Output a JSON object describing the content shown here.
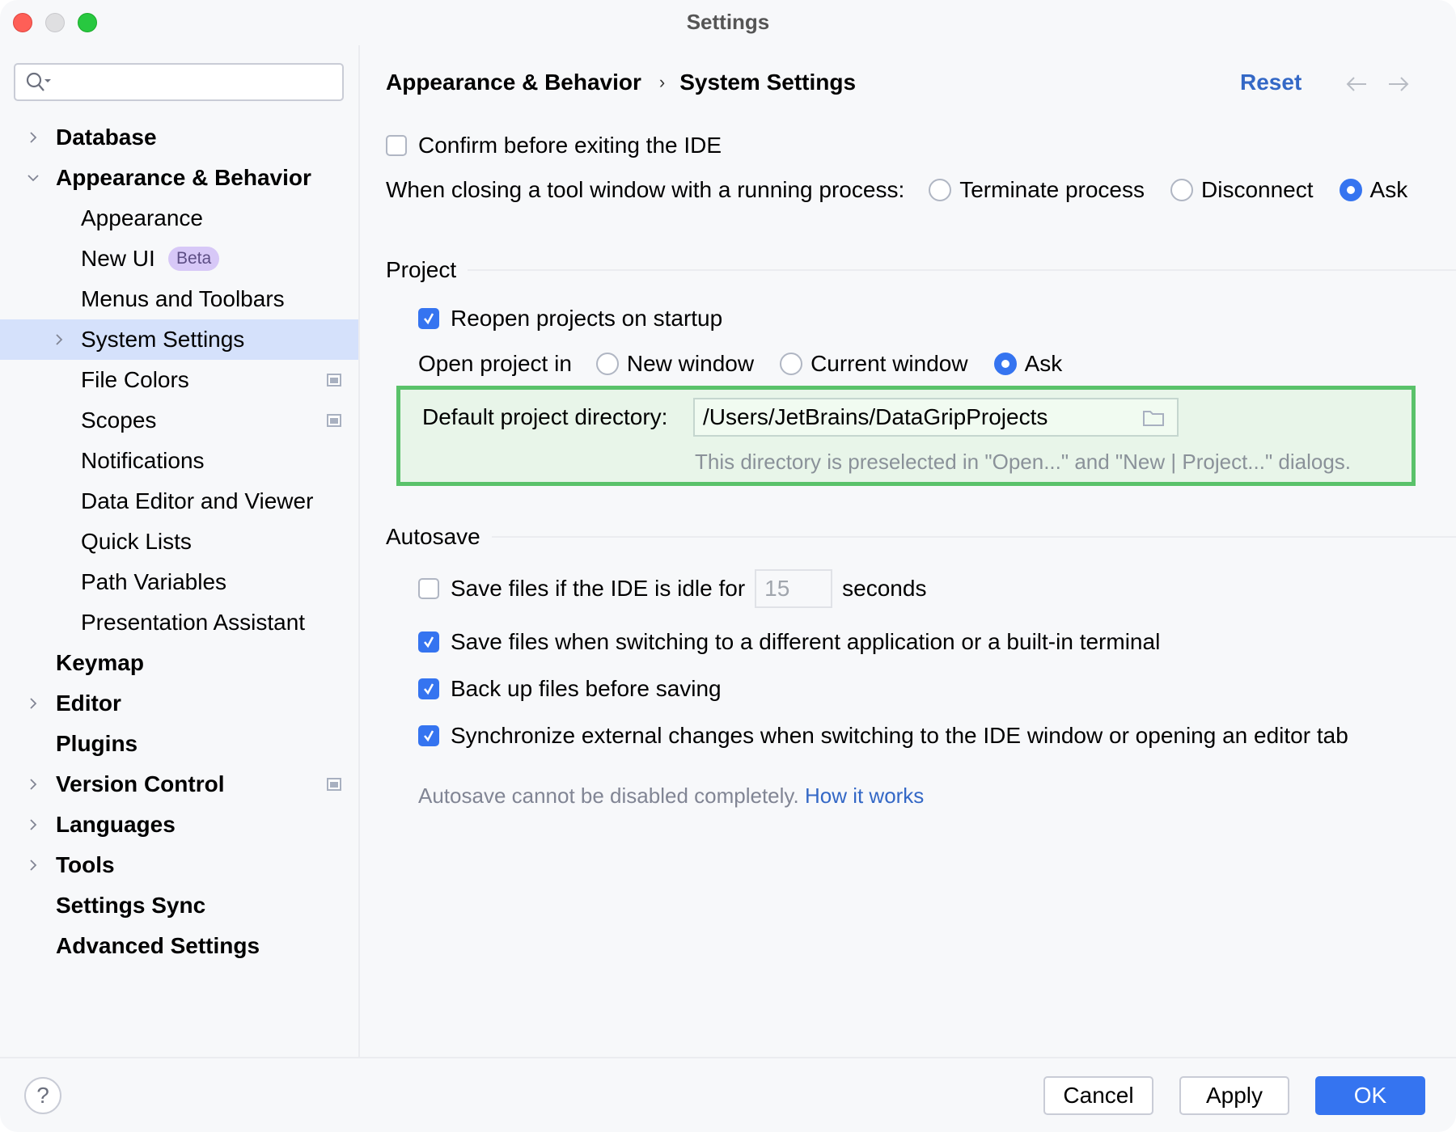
{
  "window": {
    "title": "Settings"
  },
  "search": {
    "placeholder": "",
    "value": ""
  },
  "sidebar": {
    "items": [
      {
        "label": "Database",
        "level": 0,
        "chevron": "right",
        "bold": true
      },
      {
        "label": "Appearance & Behavior",
        "level": 0,
        "chevron": "down",
        "bold": true
      },
      {
        "label": "Appearance",
        "level": 1
      },
      {
        "label": "New UI",
        "level": 1,
        "badge": "Beta"
      },
      {
        "label": "Menus and Toolbars",
        "level": 1
      },
      {
        "label": "System Settings",
        "level": 1,
        "chevron": "right",
        "selected": true
      },
      {
        "label": "File Colors",
        "level": 1,
        "project_icon": true
      },
      {
        "label": "Scopes",
        "level": 1,
        "project_icon": true
      },
      {
        "label": "Notifications",
        "level": 1
      },
      {
        "label": "Data Editor and Viewer",
        "level": 1
      },
      {
        "label": "Quick Lists",
        "level": 1
      },
      {
        "label": "Path Variables",
        "level": 1
      },
      {
        "label": "Presentation Assistant",
        "level": 1
      },
      {
        "label": "Keymap",
        "level": 0,
        "bold": true
      },
      {
        "label": "Editor",
        "level": 0,
        "chevron": "right",
        "bold": true
      },
      {
        "label": "Plugins",
        "level": 0,
        "bold": true
      },
      {
        "label": "Version Control",
        "level": 0,
        "chevron": "right",
        "bold": true,
        "project_icon": true
      },
      {
        "label": "Languages",
        "level": 0,
        "chevron": "right",
        "bold": true
      },
      {
        "label": "Tools",
        "level": 0,
        "chevron": "right",
        "bold": true
      },
      {
        "label": "Settings Sync",
        "level": 0,
        "bold": true
      },
      {
        "label": "Advanced Settings",
        "level": 0,
        "bold": true
      }
    ]
  },
  "header": {
    "breadcrumb": [
      "Appearance & Behavior",
      "System Settings"
    ],
    "breadcrumb_separator": "›",
    "reset_label": "Reset"
  },
  "general": {
    "confirm_exit": {
      "label": "Confirm before exiting the IDE",
      "checked": false
    },
    "closing_tool_window": {
      "label": "When closing a tool window with a running process:",
      "options": [
        {
          "label": "Terminate process",
          "checked": false
        },
        {
          "label": "Disconnect",
          "checked": false
        },
        {
          "label": "Ask",
          "checked": true
        }
      ]
    }
  },
  "project": {
    "title": "Project",
    "reopen": {
      "label": "Reopen projects on startup",
      "checked": true
    },
    "open_in": {
      "label": "Open project in",
      "options": [
        {
          "label": "New window",
          "checked": false
        },
        {
          "label": "Current window",
          "checked": false
        },
        {
          "label": "Ask",
          "checked": true
        }
      ]
    },
    "default_dir": {
      "label": "Default project directory:",
      "value": "/Users/JetBrains/DataGripProjects",
      "hint": "This directory is preselected in \"Open...\" and \"New | Project...\" dialogs."
    }
  },
  "autosave": {
    "title": "Autosave",
    "idle": {
      "label_before": "Save files if the IDE is idle for",
      "value": "15",
      "label_after": "seconds",
      "checked": false
    },
    "switching": {
      "label": "Save files when switching to a different application or a built-in terminal",
      "checked": true
    },
    "backup": {
      "label": "Back up files before saving",
      "checked": true
    },
    "sync": {
      "label": "Synchronize external changes when switching to the IDE window or opening an editor tab",
      "checked": true
    },
    "note": "Autosave cannot be disabled completely.",
    "note_link": "How it works"
  },
  "footer": {
    "help_label": "?",
    "cancel_label": "Cancel",
    "apply_label": "Apply",
    "ok_label": "OK"
  },
  "colors": {
    "accent": "#3574f0",
    "link": "#3468c6",
    "selection": "#d5e1fb",
    "highlight_border": "#5ac26a",
    "highlight_bg": "#e8f5e9",
    "beta_badge": "#d7c8f7"
  }
}
